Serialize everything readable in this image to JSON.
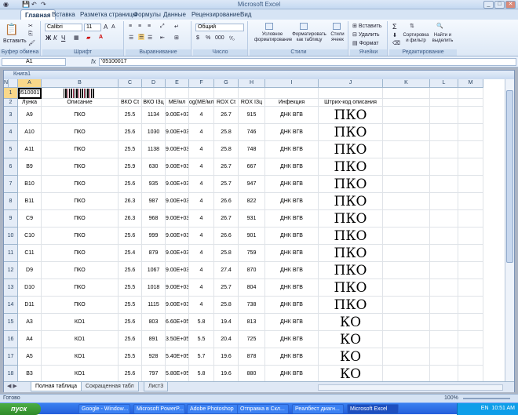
{
  "window": {
    "title": "Microsoft Excel",
    "min": "_",
    "max": "□",
    "close": "✕"
  },
  "qat": {
    "office_btn": "",
    "save": "💾",
    "undo": "↶",
    "redo": "↷"
  },
  "tabs": [
    "Главная",
    "Вставка",
    "Разметка страницы",
    "Формулы",
    "Данные",
    "Рецензирование",
    "Вид"
  ],
  "ribbon": {
    "clipboard": {
      "paste": "Вставить",
      "label": "Буфер обмена"
    },
    "font": {
      "name": "Calibri",
      "size": "11",
      "bold": "Ж",
      "italic": "К",
      "underline": "Ч",
      "grow": "A",
      "shrink": "A",
      "label": "Шрифт"
    },
    "align": {
      "label": "Выравнивание"
    },
    "number": {
      "format": "Общий",
      "currency": "$",
      "percent": "%",
      "thousands": "000",
      "label": "Число"
    },
    "styles": {
      "cond": "Условное форматирование",
      "table": "Форматировать как таблицу",
      "cell": "Стили ячеек",
      "label": "Стили"
    },
    "cells": {
      "insert": "Вставить",
      "delete": "Удалить",
      "format": "Формат",
      "label": "Ячейки"
    },
    "editing": {
      "sigma": "Σ",
      "sort": "Сортировка и фильтр",
      "find": "Найти и выделить",
      "label": "Редактирование"
    }
  },
  "formula_bar": {
    "name_box": "A1",
    "fx": "fx",
    "value": "'05100017"
  },
  "workbook": {
    "title": "Книга1"
  },
  "columns": [
    "A",
    "B",
    "C",
    "D",
    "E",
    "F",
    "G",
    "H",
    "I",
    "J",
    "K",
    "L",
    "M",
    "N"
  ],
  "row_numbers": [
    "1",
    "2",
    "3",
    "4",
    "5",
    "6",
    "7",
    "8",
    "9",
    "10",
    "11",
    "12",
    "13",
    "14",
    "15",
    "16",
    "17",
    "18"
  ],
  "row1": {
    "a": "05100017"
  },
  "headers": [
    "Лунка",
    "Описание",
    "ВКО Ct",
    "ВКО IЗц",
    "МЕ/мл",
    "og(МЕ/мл",
    "ROX Ct",
    "ROX IЗц",
    "Инфекция",
    "Штрих-код описания"
  ],
  "rows": [
    [
      "A9",
      "ПКО",
      "25.5",
      "1134",
      "9.00E+03",
      "4",
      "26.7",
      "915",
      "ДНК ВГВ",
      "ПКО"
    ],
    [
      "A10",
      "ПКО",
      "25.6",
      "1030",
      "9.00E+03",
      "4",
      "25.8",
      "746",
      "ДНК ВГВ",
      "ПКО"
    ],
    [
      "A11",
      "ПКО",
      "25.5",
      "1138",
      "9.00E+03",
      "4",
      "25.8",
      "748",
      "ДНК ВГВ",
      "ПКО"
    ],
    [
      "B9",
      "ПКО",
      "25.9",
      "630",
      "9.00E+03",
      "4",
      "26.7",
      "667",
      "ДНК ВГВ",
      "ПКО"
    ],
    [
      "B10",
      "ПКО",
      "25.6",
      "935",
      "9.00E+03",
      "4",
      "25.7",
      "947",
      "ДНК ВГВ",
      "ПКО"
    ],
    [
      "B11",
      "ПКО",
      "26.3",
      "987",
      "9.00E+03",
      "4",
      "26.6",
      "822",
      "ДНК ВГВ",
      "ПКО"
    ],
    [
      "C9",
      "ПКО",
      "26.3",
      "968",
      "9.00E+03",
      "4",
      "26.7",
      "931",
      "ДНК ВГВ",
      "ПКО"
    ],
    [
      "C10",
      "ПКО",
      "25.6",
      "999",
      "9.00E+03",
      "4",
      "26.6",
      "901",
      "ДНК ВГВ",
      "ПКО"
    ],
    [
      "C11",
      "ПКО",
      "25.4",
      "879",
      "9.00E+03",
      "4",
      "25.8",
      "759",
      "ДНК ВГВ",
      "ПКО"
    ],
    [
      "D9",
      "ПКО",
      "25.6",
      "1067",
      "9.00E+03",
      "4",
      "27.4",
      "870",
      "ДНК ВГВ",
      "ПКО"
    ],
    [
      "D10",
      "ПКО",
      "25.5",
      "1018",
      "9.00E+03",
      "4",
      "25.7",
      "804",
      "ДНК ВГВ",
      "ПКО"
    ],
    [
      "D11",
      "ПКО",
      "25.5",
      "1115",
      "9.00E+03",
      "4",
      "25.8",
      "738",
      "ДНК ВГВ",
      "ПКО"
    ],
    [
      "A3",
      "КО1",
      "25.6",
      "803",
      "6.60E+05",
      "5.8",
      "19.4",
      "813",
      "ДНК ВГВ",
      "КО"
    ],
    [
      "A4",
      "КО1",
      "25.6",
      "891",
      "3.50E+05",
      "5.5",
      "20.4",
      "725",
      "ДНК ВГВ",
      "КО"
    ],
    [
      "A5",
      "КО1",
      "25.5",
      "928",
      "5.40E+05",
      "5.7",
      "19.6",
      "878",
      "ДНК ВГВ",
      "КО"
    ],
    [
      "B3",
      "КО1",
      "25.6",
      "797",
      "5.80E+05",
      "5.8",
      "19.6",
      "880",
      "ДНК ВГВ",
      "КО"
    ]
  ],
  "sheets": [
    "Полная таблица",
    "Сокращенная табл",
    "Лист3"
  ],
  "status": {
    "ready": "Готово",
    "zoom": "100%"
  },
  "taskbar": {
    "start": "пуск",
    "items": [
      "",
      "Google - Window...",
      "Microsoft PowerP...",
      "Adobe Photoshop",
      "Отправка в Скл...",
      "Реалбест диагн...",
      "Microsoft Excel"
    ],
    "lang": "EN",
    "clock": "10:51 AM"
  }
}
